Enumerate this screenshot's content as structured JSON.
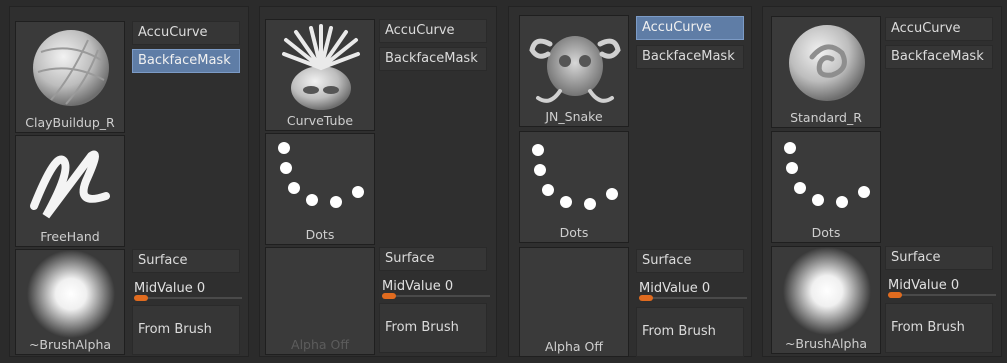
{
  "panels": [
    {
      "brush": {
        "label": "ClayBuildup_R",
        "icon": "clay-buildup-brush-icon"
      },
      "stroke": {
        "label": "FreeHand",
        "icon": "freehand-stroke-icon"
      },
      "alpha": {
        "label": "~BrushAlpha",
        "icon": "brush-alpha-icon"
      },
      "accu_curve": "AccuCurve",
      "backface_mask": "BackfaceMask",
      "accu_on": false,
      "backface_on": true,
      "surface": "Surface",
      "midvalue": "MidValue 0",
      "from_brush": "From Brush"
    },
    {
      "brush": {
        "label": "CurveTube",
        "icon": "curve-tube-brush-icon"
      },
      "stroke": {
        "label": "Dots",
        "icon": "dots-stroke-icon"
      },
      "alpha": {
        "label": "Alpha Off",
        "icon": "alpha-off-icon"
      },
      "accu_curve": "AccuCurve",
      "backface_mask": "BackfaceMask",
      "accu_on": false,
      "backface_on": false,
      "surface": "Surface",
      "midvalue": "MidValue 0",
      "from_brush": "From Brush"
    },
    {
      "brush": {
        "label": "JN_Snake",
        "icon": "jn-snake-brush-icon"
      },
      "stroke": {
        "label": "Dots",
        "icon": "dots-stroke-icon"
      },
      "alpha": {
        "label": "Alpha Off",
        "icon": "alpha-off-icon"
      },
      "accu_curve": "AccuCurve",
      "backface_mask": "BackfaceMask",
      "accu_on": true,
      "backface_on": false,
      "surface": "Surface",
      "midvalue": "MidValue 0",
      "from_brush": "From Brush"
    },
    {
      "brush": {
        "label": "Standard_R",
        "icon": "standard-brush-icon"
      },
      "stroke": {
        "label": "Dots",
        "icon": "dots-stroke-icon"
      },
      "alpha": {
        "label": "~BrushAlpha",
        "icon": "brush-alpha-icon"
      },
      "accu_curve": "AccuCurve",
      "backface_mask": "BackfaceMask",
      "accu_on": false,
      "backface_on": false,
      "surface": "Surface",
      "midvalue": "MidValue 0",
      "from_brush": "From Brush"
    }
  ],
  "colors": {
    "active_button": "#5f7da6",
    "slider_knob": "#e06b1f",
    "panel_bg": "#2f2f2f"
  }
}
